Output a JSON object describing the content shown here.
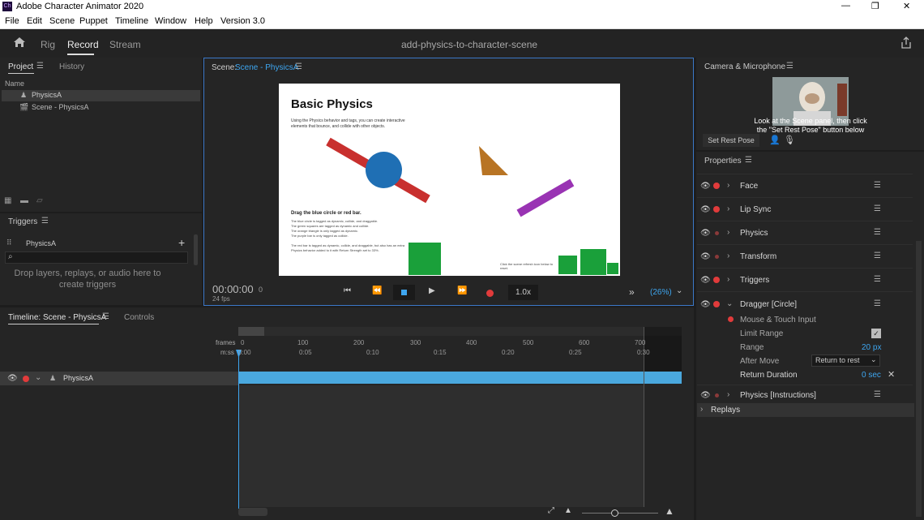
{
  "app": {
    "title": "Adobe Character Animator 2020",
    "icon_text": "Ch"
  },
  "window_controls": {
    "minimize": "—",
    "maximize": "❐",
    "close": "✕"
  },
  "menu": [
    "File",
    "Edit",
    "Scene",
    "Puppet",
    "Timeline",
    "Window",
    "Help",
    "Version 3.0"
  ],
  "modes": {
    "home_icon": "home-icon",
    "tabs": [
      "Rig",
      "Record",
      "Stream"
    ],
    "active": "Record",
    "doc_title": "add-physics-to-character-scene"
  },
  "project": {
    "tabs": [
      "Project",
      "History"
    ],
    "col_header": "Name",
    "items": [
      "PhysicsA",
      "Scene - PhysicsA"
    ]
  },
  "triggers": {
    "title": "Triggers",
    "item": "PhysicsA",
    "add": "+",
    "placeholder": "",
    "drop_text": "Drop layers, replays, or audio here to create triggers"
  },
  "scene": {
    "header_prefix": "Scene:",
    "header_name": "Scene - PhysicsA",
    "slide_title": "Basic Physics",
    "slide_intro": "Using the Physics behavior and tags, you can create interactive elements that bounce, and collide with other objects.",
    "slide_drag": "Drag the blue circle or red bar.",
    "slide_notes": [
      "The blue circle is tagged as dynamic, collide, and draggable.",
      "The green squares are tagged as dynamic and collide.",
      "The orange triangle is only tagged as dynamic.",
      "The purple bar is only tagged as collide."
    ],
    "slide_note2": "The red bar is tagged as dynamic, collide, and draggable, but also has an extra Physics behavior added to it with Return Strength set to 33%.",
    "slide_footer": "Click the scene refresh icon below to reset.",
    "timecode": "00:00:00",
    "frame": "0",
    "fps": "24 fps",
    "speed": "1.0x",
    "zoom": "(26%)",
    "more": "»"
  },
  "camera": {
    "title": "Camera & Microphone",
    "hint": "Look at the Scene panel, then click the \"Set Rest Pose\" button below",
    "rest_pose": "Set Rest Pose"
  },
  "properties": {
    "title": "Properties",
    "behaviors": [
      "Face",
      "Lip Sync",
      "Physics",
      "Transform",
      "Triggers",
      "Dragger [Circle]"
    ],
    "dragger": {
      "input": "Mouse & Touch Input",
      "limit_range": "Limit Range",
      "range_label": "Range",
      "range_value": "20 px",
      "after_move_label": "After Move",
      "after_move_value": "Return to rest",
      "return_duration_label": "Return Duration",
      "return_duration_value": "0 sec"
    },
    "last": "Physics [Instructions]",
    "replays": "Replays"
  },
  "timeline": {
    "tabs": [
      "Timeline: Scene - PhysicsA",
      "Controls"
    ],
    "frames_label": "frames",
    "mss_label": "m:ss",
    "frame_ticks": [
      "0",
      "100",
      "200",
      "300",
      "400",
      "500",
      "600",
      "700"
    ],
    "time_ticks": [
      "0:00",
      "0:05",
      "0:10",
      "0:15",
      "0:20",
      "0:25",
      "0:30"
    ],
    "track": "PhysicsA"
  }
}
